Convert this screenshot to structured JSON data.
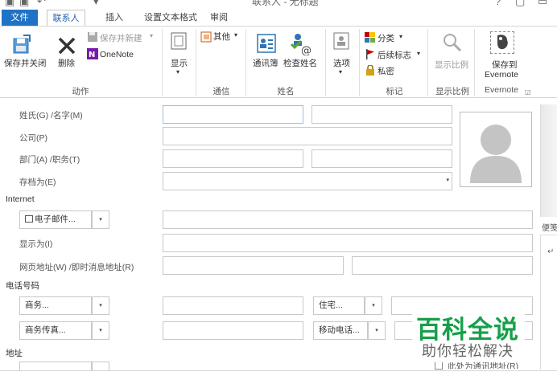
{
  "titlebar": {
    "title": "联系人 - 无标题"
  },
  "tabs": [
    "文件",
    "联系人",
    "插入",
    "设置文本格式",
    "审阅"
  ],
  "ribbon": {
    "action": {
      "save_close": "保存并关闭",
      "delete": "删除",
      "save_new": "保存并新建",
      "onenote": "OneNote",
      "group_label": "动作"
    },
    "show": {
      "label": "显示",
      "group_label": ""
    },
    "communicate": {
      "other": "其他",
      "group_label": "通信"
    },
    "names": {
      "address_book": "通讯簿",
      "check_names": "检查姓名",
      "group_label": "姓名"
    },
    "options": {
      "label": "选项"
    },
    "tags": {
      "categorize": "分类",
      "follow_up": "后续标志",
      "private": "私密",
      "group_label": "标记"
    },
    "zoom": {
      "label": "显示比例",
      "group_label": "显示比例"
    },
    "evernote": {
      "save_to": "保存到",
      "evernote": "Evernote",
      "group_label": "Evernote"
    }
  },
  "form": {
    "fullname_label": "姓氏(G) /名字(M)",
    "company_label": "公司(P)",
    "dept_label": "部门(A) /职务(T)",
    "fileas_label": "存档为(E)",
    "internet_section": "Internet",
    "email_button": "电子邮件...",
    "display_as_label": "显示为(I)",
    "web_label": "网页地址(W) /即时消息地址(R)",
    "phone_section": "电话号码",
    "business_phone": "商务...",
    "home_phone": "住宅...",
    "business_fax": "商务传真...",
    "mobile_phone": "移动电话...",
    "address_section": "地址",
    "mailing_checkbox": "此处为通讯地址(R)"
  },
  "side": {
    "notes_label": "便笺"
  },
  "watermark": {
    "title": "百科全说",
    "subtitle": "助你轻松解决"
  }
}
